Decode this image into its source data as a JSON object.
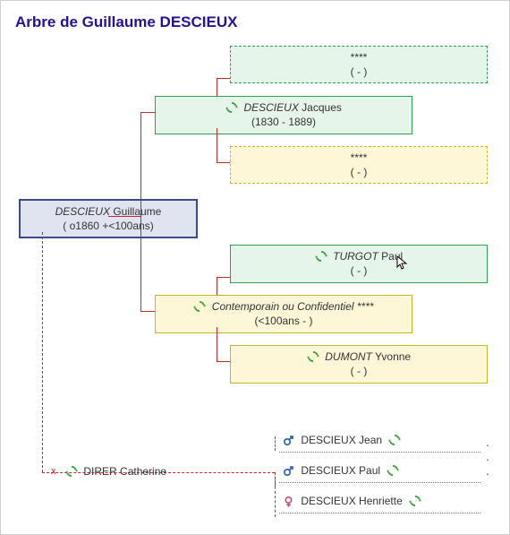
{
  "title": "Arbre de Guillaume DESCIEUX",
  "subject": {
    "surname": "DESCIEUX",
    "given": "Guillaume",
    "dates": "( o1860 +<100ans)"
  },
  "father": {
    "grandfather": {
      "name": "****",
      "dates": "( - )"
    },
    "self": {
      "surname": "DESCIEUX",
      "given": "Jacques",
      "dates": "(1830 - 1889)"
    },
    "grandmother": {
      "name": "****",
      "dates": "( - )"
    }
  },
  "mother": {
    "grandfather": {
      "surname": "TURGOT",
      "given": "Paul",
      "dates": "( - )"
    },
    "self": {
      "label": "Contemporain ou Confidentiel ****",
      "dates": "(<100ans - )"
    },
    "grandmother": {
      "surname": "DUMONT",
      "given": "Yvonne",
      "dates": "( - )"
    }
  },
  "spouse": {
    "surname": "DIRER",
    "given": "Catherine"
  },
  "children": [
    {
      "gender": "m",
      "surname": "DESCIEUX",
      "given": "Jean"
    },
    {
      "gender": "m",
      "surname": "DESCIEUX",
      "given": "Paul"
    },
    {
      "gender": "f",
      "surname": "DESCIEUX",
      "given": "Henriette"
    }
  ],
  "ellipsis": ". . ."
}
